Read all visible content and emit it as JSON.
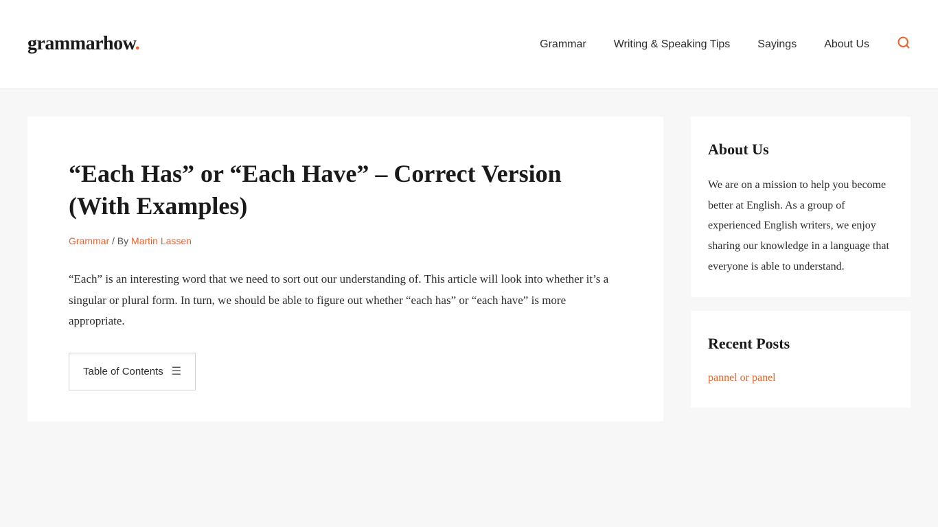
{
  "header": {
    "logo_text": "grammarhow",
    "logo_dot": ".",
    "nav_items": [
      {
        "label": "Grammar",
        "id": "grammar"
      },
      {
        "label": "Writing & Speaking Tips",
        "id": "writing-speaking-tips"
      },
      {
        "label": "Sayings",
        "id": "sayings"
      },
      {
        "label": "About Us",
        "id": "about-us"
      }
    ],
    "search_icon": "🔍"
  },
  "article": {
    "title": "“Each Has” or “Each Have” – Correct Version (With Examples)",
    "meta": {
      "category": "Grammar",
      "separator": " / By ",
      "author": "Martin Lassen"
    },
    "intro": "“Each” is an interesting word that we need to sort out our understanding of. This article will look into whether it’s a singular or plural form. In turn, we should be able to figure out whether “each has” or “each have” is more appropriate.",
    "toc": {
      "label": "Table of Contents",
      "icon": "☰"
    }
  },
  "sidebar": {
    "about_us": {
      "heading": "About Us",
      "text": "We are on a mission to help you become better at English. As a group of experienced English writers, we enjoy sharing our knowledge in a language that everyone is able to understand."
    },
    "recent_posts": {
      "heading": "Recent Posts",
      "link_text": "pannel or panel"
    }
  }
}
